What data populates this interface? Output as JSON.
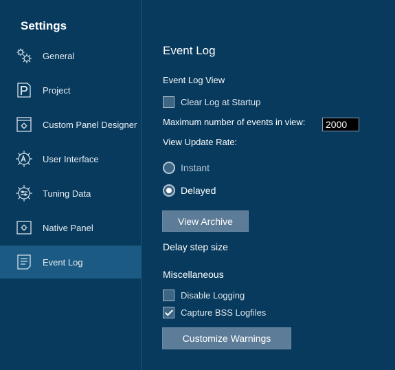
{
  "sidebar": {
    "title": "Settings",
    "items": [
      {
        "label": "General",
        "icon": "gears-icon"
      },
      {
        "label": "Project",
        "icon": "project-p-icon"
      },
      {
        "label": "Custom Panel Designer",
        "icon": "panel-designer-icon"
      },
      {
        "label": "User Interface",
        "icon": "user-interface-gear-icon"
      },
      {
        "label": "Tuning Data",
        "icon": "tuning-gear-icon"
      },
      {
        "label": "Native Panel",
        "icon": "native-panel-icon"
      },
      {
        "label": "Event Log",
        "icon": "event-log-document-icon",
        "active": true
      }
    ]
  },
  "main": {
    "title": "Event Log",
    "event_log_view": {
      "heading": "Event Log View",
      "clear_log_label": "Clear Log at Startup",
      "clear_log_checked": false,
      "max_events_label": "Maximum number of events in view:",
      "max_events_value": "2000",
      "update_rate_label": "View Update Rate:",
      "rate_options": [
        {
          "label": "Instant",
          "selected": false
        },
        {
          "label": "Delayed",
          "selected": true
        }
      ],
      "view_archive_button": "View Archive",
      "delay_step_label": "Delay step size"
    },
    "miscellaneous": {
      "heading": "Miscellaneous",
      "disable_logging_label": "Disable Logging",
      "disable_logging_checked": false,
      "capture_bss_label": "Capture BSS Logfiles",
      "capture_bss_checked": true,
      "customize_warnings_button": "Customize Warnings"
    }
  },
  "colors": {
    "background": "#073a5d",
    "active_item": "#1b5a82",
    "button": "#5d7c98"
  }
}
